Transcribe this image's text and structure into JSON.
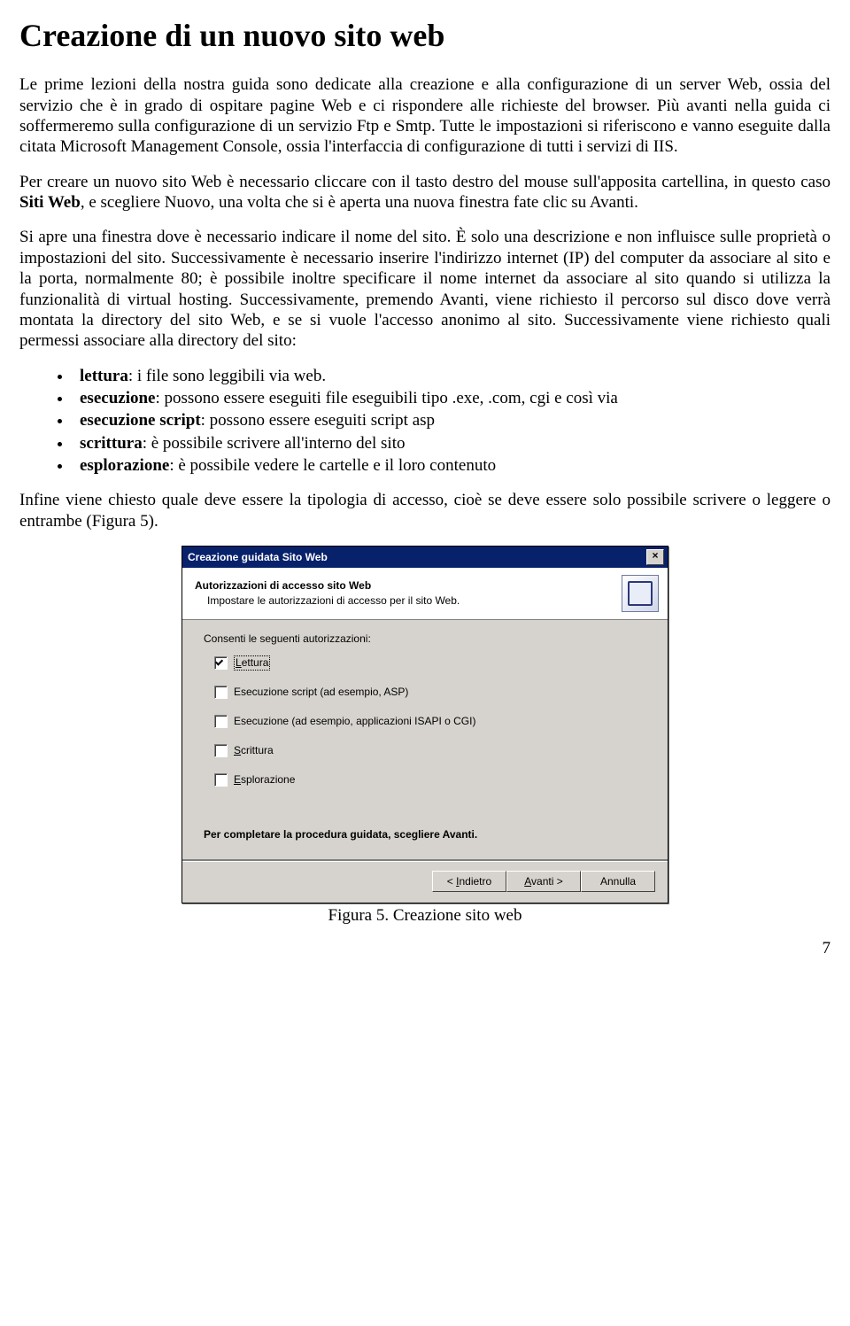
{
  "title": "Creazione di un nuovo sito web",
  "paragraphs": {
    "p1": "Le prime lezioni della nostra guida sono dedicate alla creazione e alla configurazione di un server Web, ossia del servizio che è in grado di ospitare pagine Web e ci rispondere alle richieste del browser. Più avanti nella guida ci soffermeremo sulla configurazione di un servizio Ftp e Smtp. Tutte le impostazioni si riferiscono e vanno eseguite dalla citata Microsoft Management Console, ossia l'interfaccia di configurazione di tutti i servizi di IIS.",
    "p2_a": "Per creare un nuovo sito Web è necessario cliccare con il tasto destro del mouse sull'apposita cartellina, in questo caso ",
    "p2_b": "Siti Web",
    "p2_c": ", e scegliere Nuovo, una volta che si è aperta una nuova finestra fate clic su Avanti.",
    "p3": "Si apre una finestra dove è necessario indicare il nome del sito. È solo una descrizione e non influisce sulle proprietà o impostazioni del sito. Successivamente è necessario inserire l'indirizzo internet (IP) del computer da associare al sito e la porta, normalmente 80; è possibile inoltre specificare il nome internet da associare al sito quando si utilizza la funzionalità di virtual hosting. Successivamente, premendo Avanti, viene richiesto il percorso sul disco dove verrà montata la directory del sito Web, e se si vuole l'accesso anonimo al sito. Successivamente viene richiesto quali permessi associare alla directory del sito:"
  },
  "permissions": [
    {
      "term": "lettura",
      "desc": ": i file sono leggibili via web."
    },
    {
      "term": "esecuzione",
      "desc": ": possono essere eseguiti file eseguibili tipo .exe, .com, cgi e così via"
    },
    {
      "term": "esecuzione script",
      "desc": ": possono essere eseguiti script asp"
    },
    {
      "term": "scrittura",
      "desc": ": è possibile scrivere all'interno del sito"
    },
    {
      "term": "esplorazione",
      "desc": ": è possibile vedere le cartelle e il loro contenuto"
    }
  ],
  "p4": "Infine viene chiesto quale deve essere la tipologia di accesso, cioè se deve essere solo possibile scrivere o leggere o entrambe (Figura 5).",
  "dialog": {
    "title": "Creazione guidata Sito Web",
    "close": "×",
    "head_title": "Autorizzazioni di accesso sito Web",
    "head_sub": "Impostare le autorizzazioni di accesso per il sito Web.",
    "body_label": "Consenti le seguenti autorizzazioni:",
    "checks": [
      {
        "ul": "L",
        "rest": "ettura",
        "checked": true,
        "focused": true
      },
      {
        "ul": "",
        "rest": "Esecuzione script (ad esempio, ASP)",
        "checked": false,
        "focused": false
      },
      {
        "ul": "",
        "rest": "Esecuzione (ad esempio, applicazioni ISAPI o CGI)",
        "checked": false,
        "focused": false
      },
      {
        "ul": "S",
        "rest": "crittura",
        "checked": false,
        "focused": false
      },
      {
        "ul": "E",
        "rest": "splorazione",
        "checked": false,
        "focused": false
      }
    ],
    "complete": "Per completare la procedura guidata, scegliere Avanti.",
    "buttons": {
      "back_ul": "I",
      "back_pre": "< ",
      "back_rest": "ndietro",
      "next_ul": "A",
      "next_rest": "vanti >",
      "cancel": "Annulla"
    }
  },
  "caption": "Figura 5. Creazione sito web",
  "page_number": "7"
}
